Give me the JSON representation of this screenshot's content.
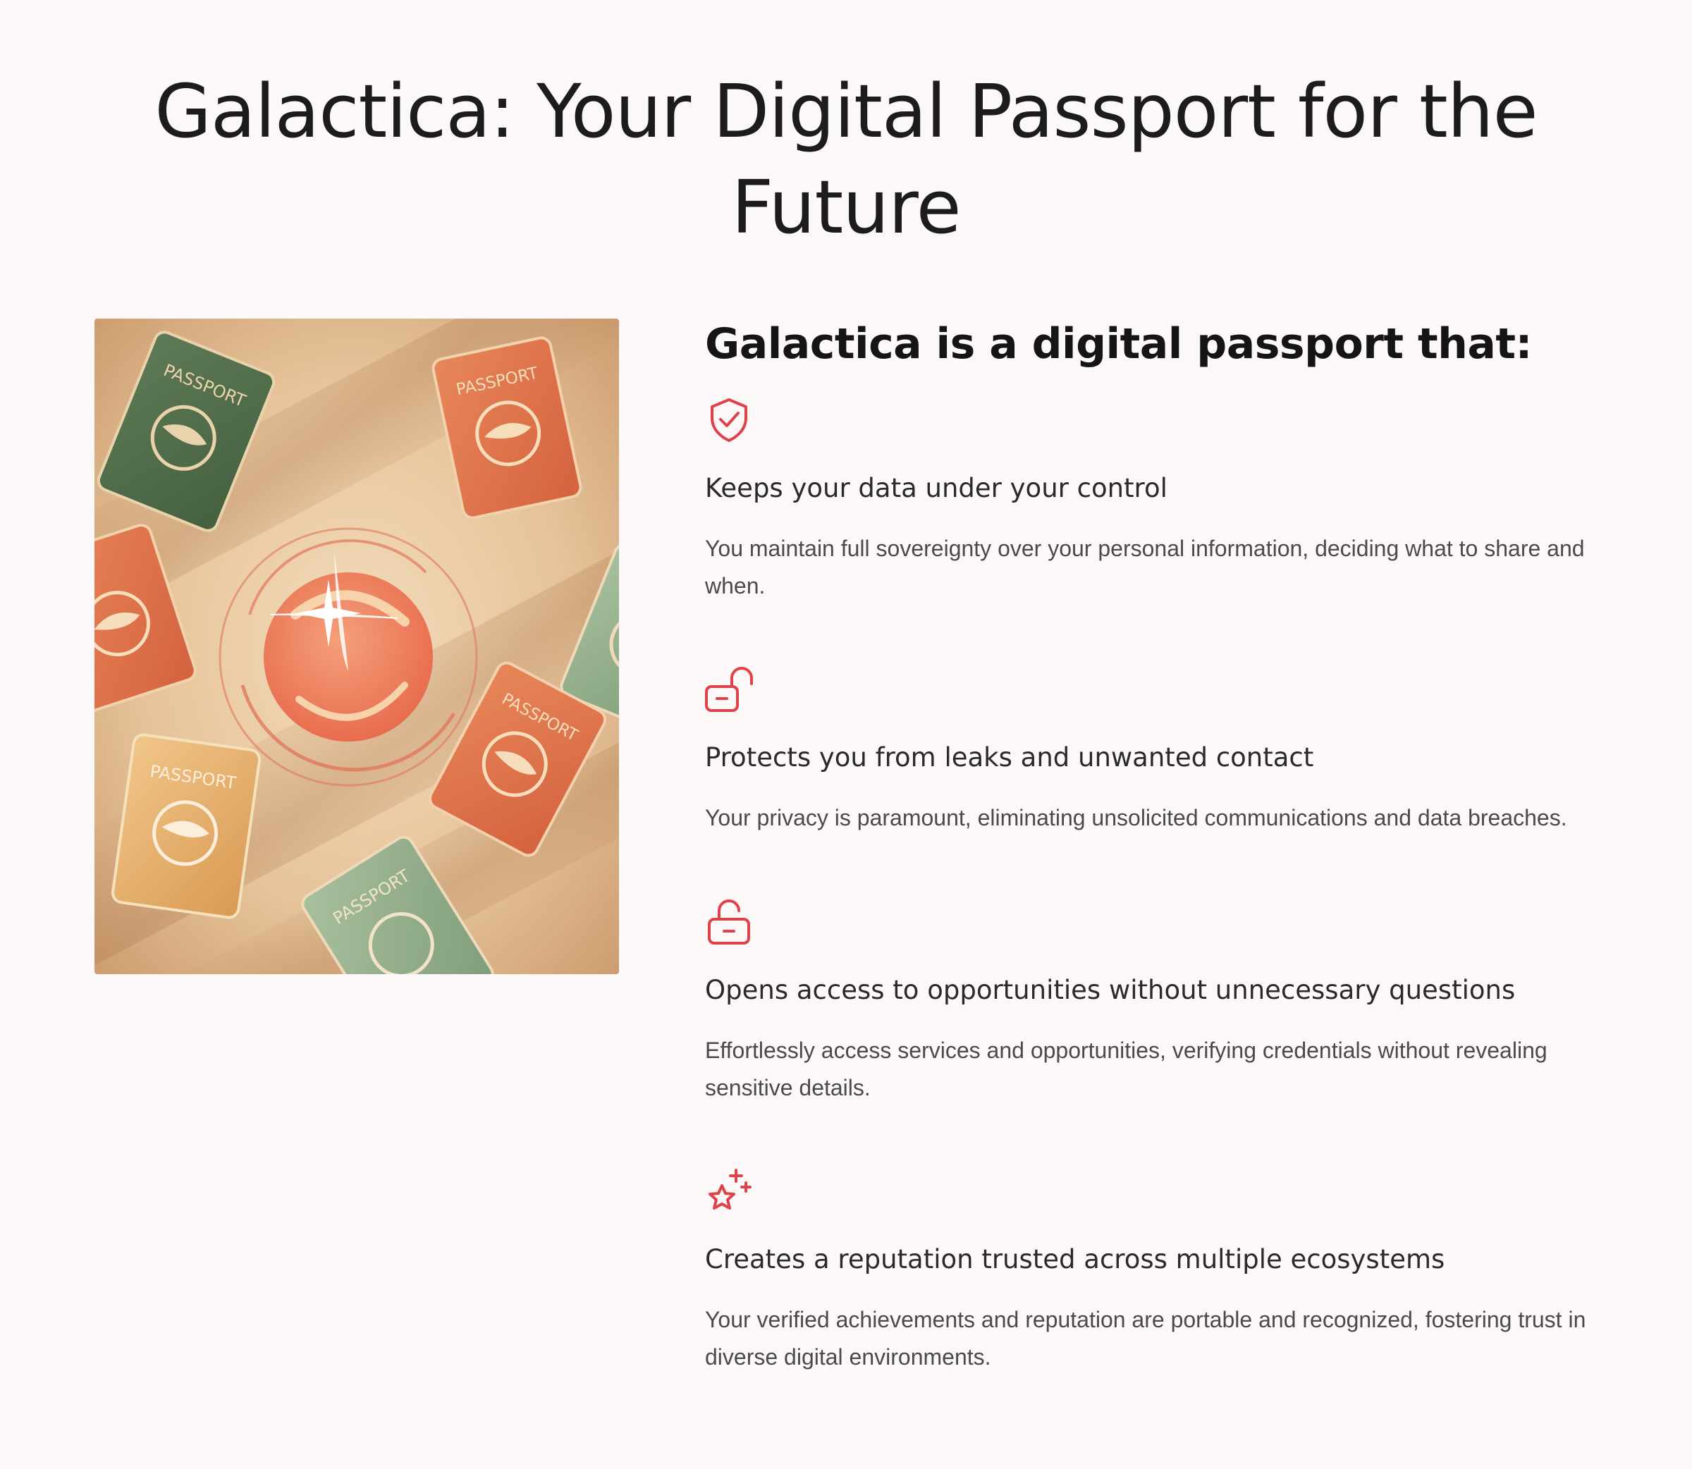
{
  "page": {
    "title": "Galactica: Your Digital Passport for the Future"
  },
  "colors": {
    "background": "#fcf8f7",
    "accent": "#e0424b",
    "heading": "#151515",
    "body_text": "#4a4a4a"
  },
  "hero": {
    "passport_label": "PASSPORT"
  },
  "section": {
    "heading": "Galactica is a digital passport that:"
  },
  "features": [
    {
      "icon": "shield-check-icon",
      "title": "Keeps your data under your control",
      "description": "You maintain full sovereignty over your personal information, deciding what to share and when."
    },
    {
      "icon": "unlock-icon",
      "title": "Protects you from leaks and unwanted contact",
      "description": "Your privacy is paramount, eliminating unsolicited communications and data breaches."
    },
    {
      "icon": "open-lock-icon",
      "title": "Opens access to opportunities without unnecessary questions",
      "description": "Effortlessly access services and opportunities, verifying credentials without revealing sensitive details."
    },
    {
      "icon": "star-sparkle-icon",
      "title": "Creates a reputation trusted across multiple ecosystems",
      "description": "Your verified achievements and reputation are portable and recognized, fostering trust in diverse digital environments."
    }
  ]
}
